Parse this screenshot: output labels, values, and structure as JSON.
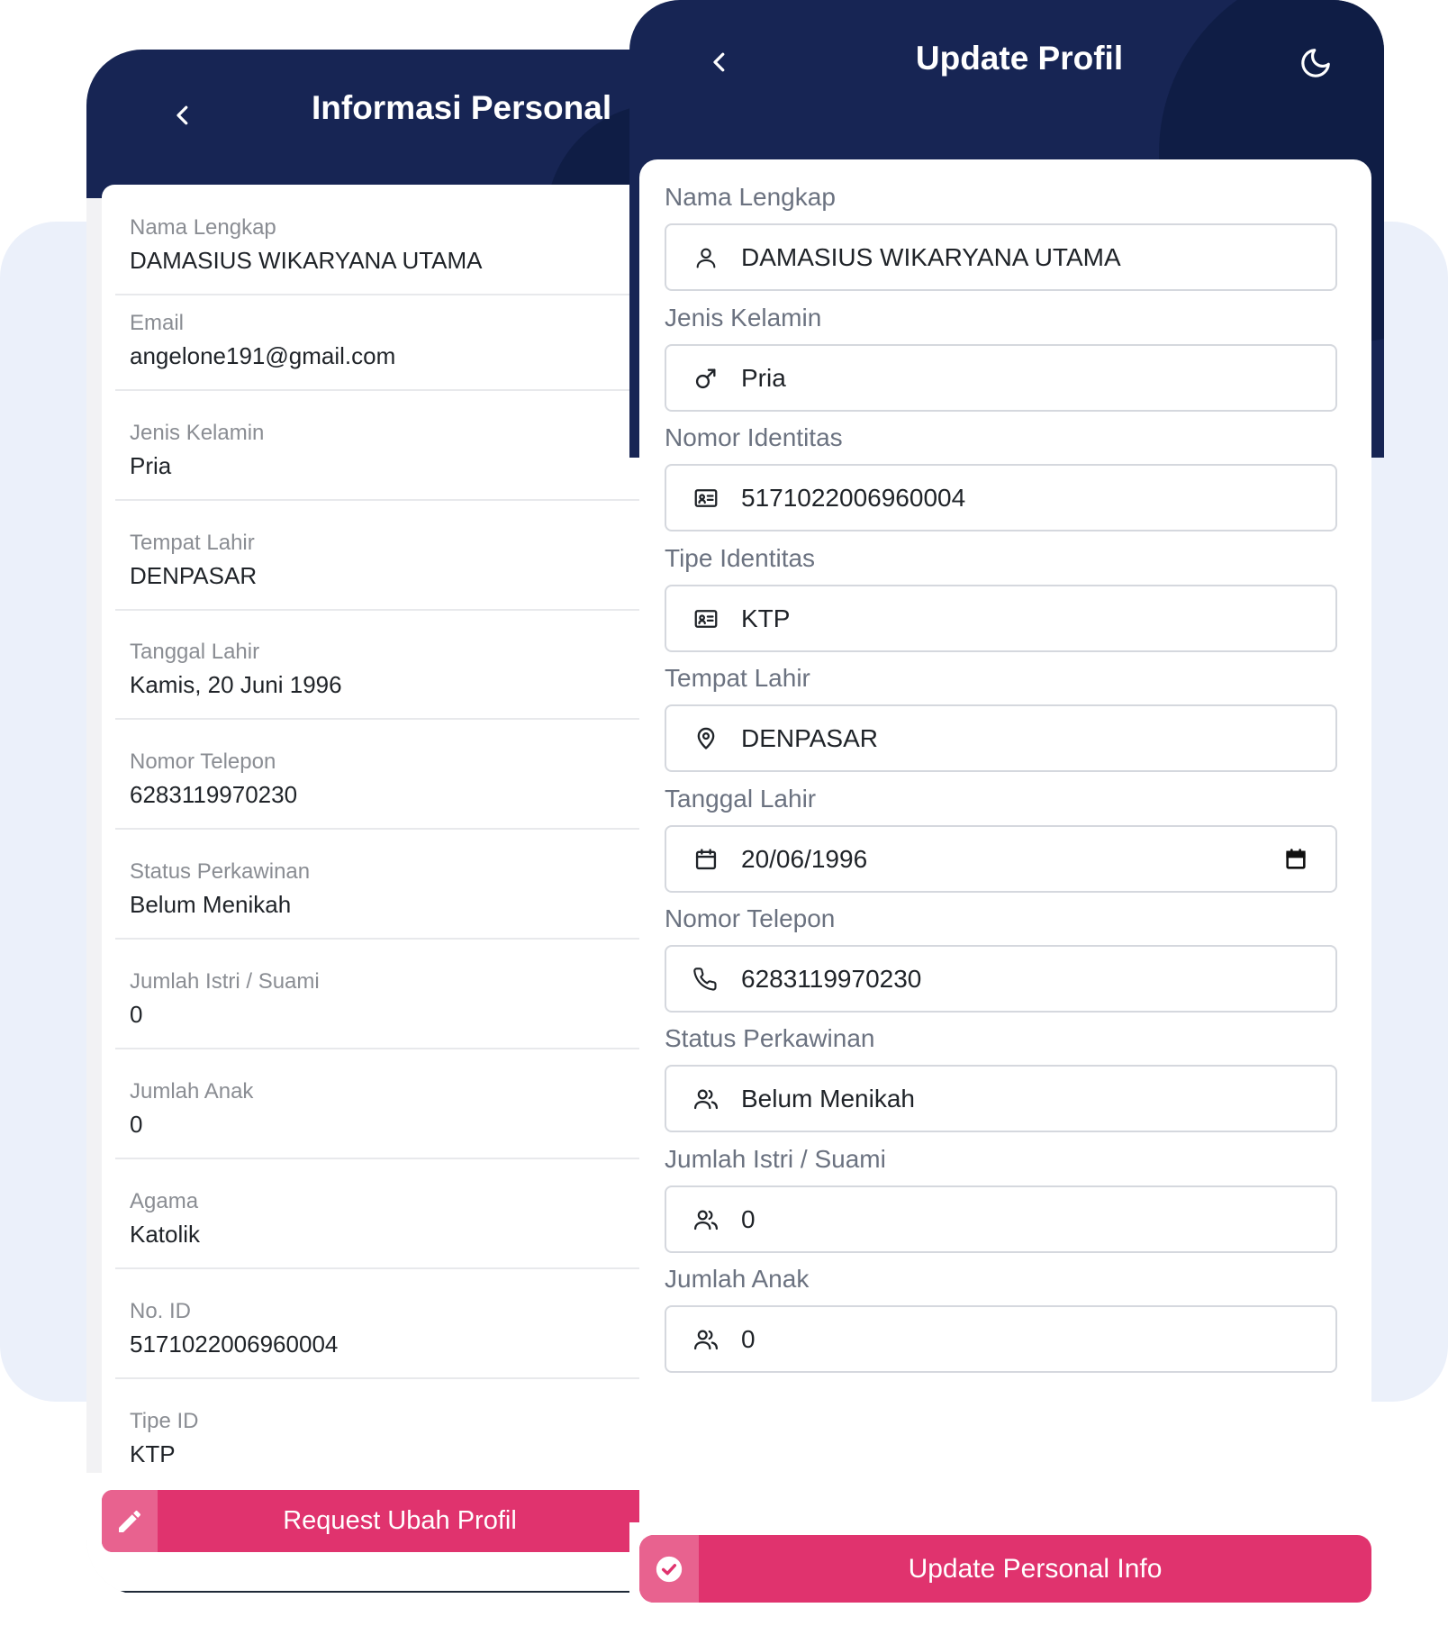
{
  "left_screen": {
    "title": "Informasi Personal",
    "fields": [
      {
        "label": "Nama Lengkap",
        "value": "DAMASIUS WIKARYANA UTAMA"
      },
      {
        "label": "Email",
        "value": "angelone191@gmail.com"
      },
      {
        "label": "Jenis Kelamin",
        "value": "Pria"
      },
      {
        "label": "Tempat Lahir",
        "value": "DENPASAR"
      },
      {
        "label": "Tanggal Lahir",
        "value": "Kamis, 20 Juni 1996"
      },
      {
        "label": "Nomor Telepon",
        "value": "6283119970230"
      },
      {
        "label": "Status Perkawinan",
        "value": "Belum Menikah"
      },
      {
        "label": "Jumlah Istri / Suami",
        "value": "0"
      },
      {
        "label": "Jumlah Anak",
        "value": "0"
      },
      {
        "label": "Agama",
        "value": "Katolik"
      },
      {
        "label": "No. ID",
        "value": "5171022006960004"
      },
      {
        "label": "Tipe ID",
        "value": "KTP"
      }
    ],
    "button_label": "Request Ubah Profil"
  },
  "right_screen": {
    "title": "Update Profil",
    "fields": [
      {
        "label": "Nama Lengkap",
        "value": "DAMASIUS WIKARYANA UTAMA",
        "icon": "user-icon"
      },
      {
        "label": "Jenis Kelamin",
        "value": "Pria",
        "icon": "male-icon"
      },
      {
        "label": "Nomor Identitas",
        "value": "5171022006960004",
        "icon": "id-card-icon"
      },
      {
        "label": "Tipe Identitas",
        "value": "KTP",
        "icon": "id-card-icon"
      },
      {
        "label": "Tempat Lahir",
        "value": "DENPASAR",
        "icon": "location-pin-icon"
      },
      {
        "label": "Tanggal Lahir",
        "value": "20/06/1996",
        "icon": "calendar-icon"
      },
      {
        "label": "Nomor Telepon",
        "value": "6283119970230",
        "icon": "phone-icon"
      },
      {
        "label": "Status Perkawinan",
        "value": "Belum Menikah",
        "icon": "users-icon"
      },
      {
        "label": "Jumlah Istri / Suami",
        "value": "0",
        "icon": "users-icon"
      },
      {
        "label": "Jumlah Anak",
        "value": "0",
        "icon": "users-icon"
      }
    ],
    "button_label": "Update Personal Info"
  },
  "colors": {
    "header": "#172554",
    "accent": "#e0336e",
    "accent_light": "#e8628f",
    "background_blob": "#ebf0fa"
  }
}
